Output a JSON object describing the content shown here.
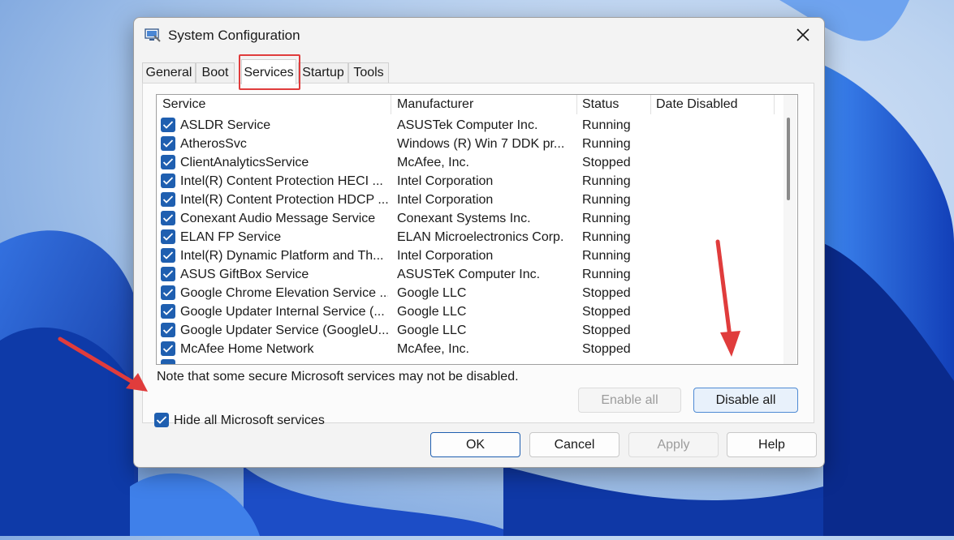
{
  "window": {
    "title": "System Configuration"
  },
  "tabs": [
    {
      "label": "General",
      "active": false
    },
    {
      "label": "Boot",
      "active": false
    },
    {
      "label": "Services",
      "active": true
    },
    {
      "label": "Startup",
      "active": false
    },
    {
      "label": "Tools",
      "active": false
    }
  ],
  "columns": {
    "service": "Service",
    "manufacturer": "Manufacturer",
    "status": "Status",
    "date_disabled": "Date Disabled"
  },
  "services": [
    {
      "service": "ASLDR Service",
      "manufacturer": "ASUSTek Computer Inc.",
      "status": "Running",
      "checked": true
    },
    {
      "service": "AtherosSvc",
      "manufacturer": "Windows (R) Win 7 DDK pr...",
      "status": "Running",
      "checked": true
    },
    {
      "service": "ClientAnalyticsService",
      "manufacturer": "McAfee, Inc.",
      "status": "Stopped",
      "checked": true
    },
    {
      "service": "Intel(R) Content Protection HECI ...",
      "manufacturer": "Intel Corporation",
      "status": "Running",
      "checked": true
    },
    {
      "service": "Intel(R) Content Protection HDCP ...",
      "manufacturer": "Intel Corporation",
      "status": "Running",
      "checked": true
    },
    {
      "service": "Conexant Audio Message Service",
      "manufacturer": "Conexant Systems Inc.",
      "status": "Running",
      "checked": true
    },
    {
      "service": "ELAN FP Service",
      "manufacturer": "ELAN Microelectronics Corp.",
      "status": "Running",
      "checked": true
    },
    {
      "service": "Intel(R) Dynamic Platform and Th...",
      "manufacturer": "Intel Corporation",
      "status": "Running",
      "checked": true
    },
    {
      "service": "ASUS GiftBox Service",
      "manufacturer": "ASUSTeK Computer Inc.",
      "status": "Running",
      "checked": true
    },
    {
      "service": "Google Chrome Elevation Service ...",
      "manufacturer": "Google LLC",
      "status": "Stopped",
      "checked": true
    },
    {
      "service": "Google Updater Internal Service (...",
      "manufacturer": "Google LLC",
      "status": "Stopped",
      "checked": true
    },
    {
      "service": "Google Updater Service (GoogleU...",
      "manufacturer": "Google LLC",
      "status": "Stopped",
      "checked": true
    },
    {
      "service": "McAfee Home Network",
      "manufacturer": "McAfee, Inc.",
      "status": "Stopped",
      "checked": true
    }
  ],
  "note": "Note that some secure Microsoft services may not be disabled.",
  "buttons": {
    "enable_all": "Enable all",
    "disable_all": "Disable all",
    "ok": "OK",
    "cancel": "Cancel",
    "apply": "Apply",
    "help": "Help"
  },
  "hide_microsoft": {
    "label": "Hide all Microsoft services",
    "checked": true
  },
  "colors": {
    "accent": "#1f5fb0",
    "annotation": "#e03c3c"
  },
  "icons": {
    "app": "system-config-icon",
    "close": "close-icon",
    "check": "checkmark-icon"
  }
}
